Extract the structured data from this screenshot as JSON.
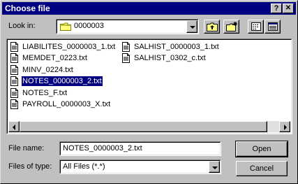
{
  "titlebar": {
    "title": "Choose file",
    "help_label": "?",
    "close_label": "✕"
  },
  "lookin": {
    "label": "Look in:",
    "folder_value": "0000003"
  },
  "files": [
    {
      "name": "LIABILITES_0000003_1.txt",
      "selected": false
    },
    {
      "name": "MEMDET_0223.txt",
      "selected": false
    },
    {
      "name": "MINV_0224.txt",
      "selected": false
    },
    {
      "name": "NOTES_0000003_2.txt",
      "selected": true
    },
    {
      "name": "NOTES_F.txt",
      "selected": false
    },
    {
      "name": "PAYROLL_0000003_X.txt",
      "selected": false
    },
    {
      "name": "SALHIST_0000003_1.txt",
      "selected": false
    },
    {
      "name": "SALHIST_0302_c.txt",
      "selected": false
    }
  ],
  "filename": {
    "label": "File name:",
    "value": "NOTES_0000003_2.txt"
  },
  "filetype": {
    "label": "Files of type:",
    "value": "All Files (*.*)"
  },
  "buttons": {
    "open": "Open",
    "cancel": "Cancel"
  }
}
